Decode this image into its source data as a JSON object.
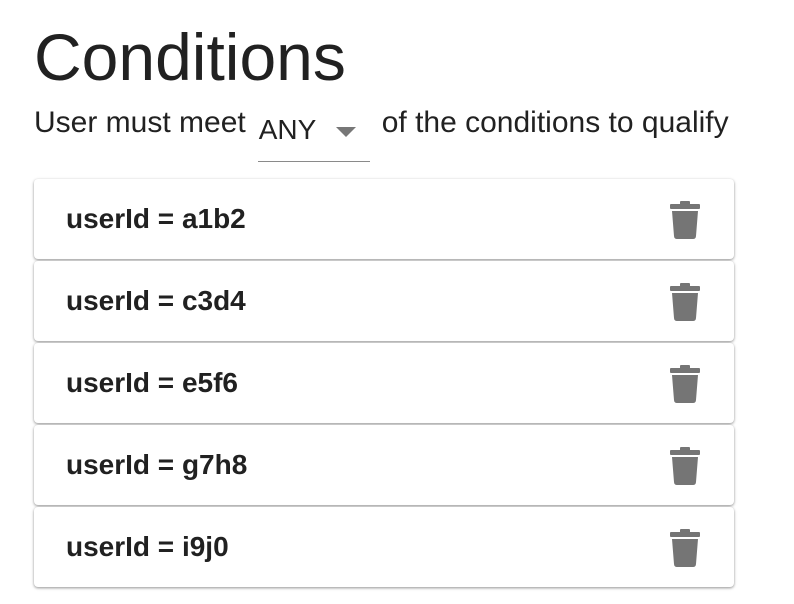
{
  "page": {
    "title": "Conditions"
  },
  "qualifier": {
    "prefix": "User must meet",
    "selected": "ANY",
    "suffix": "of the conditions to qualify"
  },
  "conditions": [
    {
      "label": "userId = a1b2"
    },
    {
      "label": "userId = c3d4"
    },
    {
      "label": "userId = e5f6"
    },
    {
      "label": "userId = g7h8"
    },
    {
      "label": "userId = i9j0"
    }
  ],
  "icons": {
    "delete": "trash-icon",
    "dropdown": "caret-down-icon"
  },
  "colors": {
    "text": "#212121",
    "icon": "#757575",
    "underline": "#8a8a8a"
  }
}
